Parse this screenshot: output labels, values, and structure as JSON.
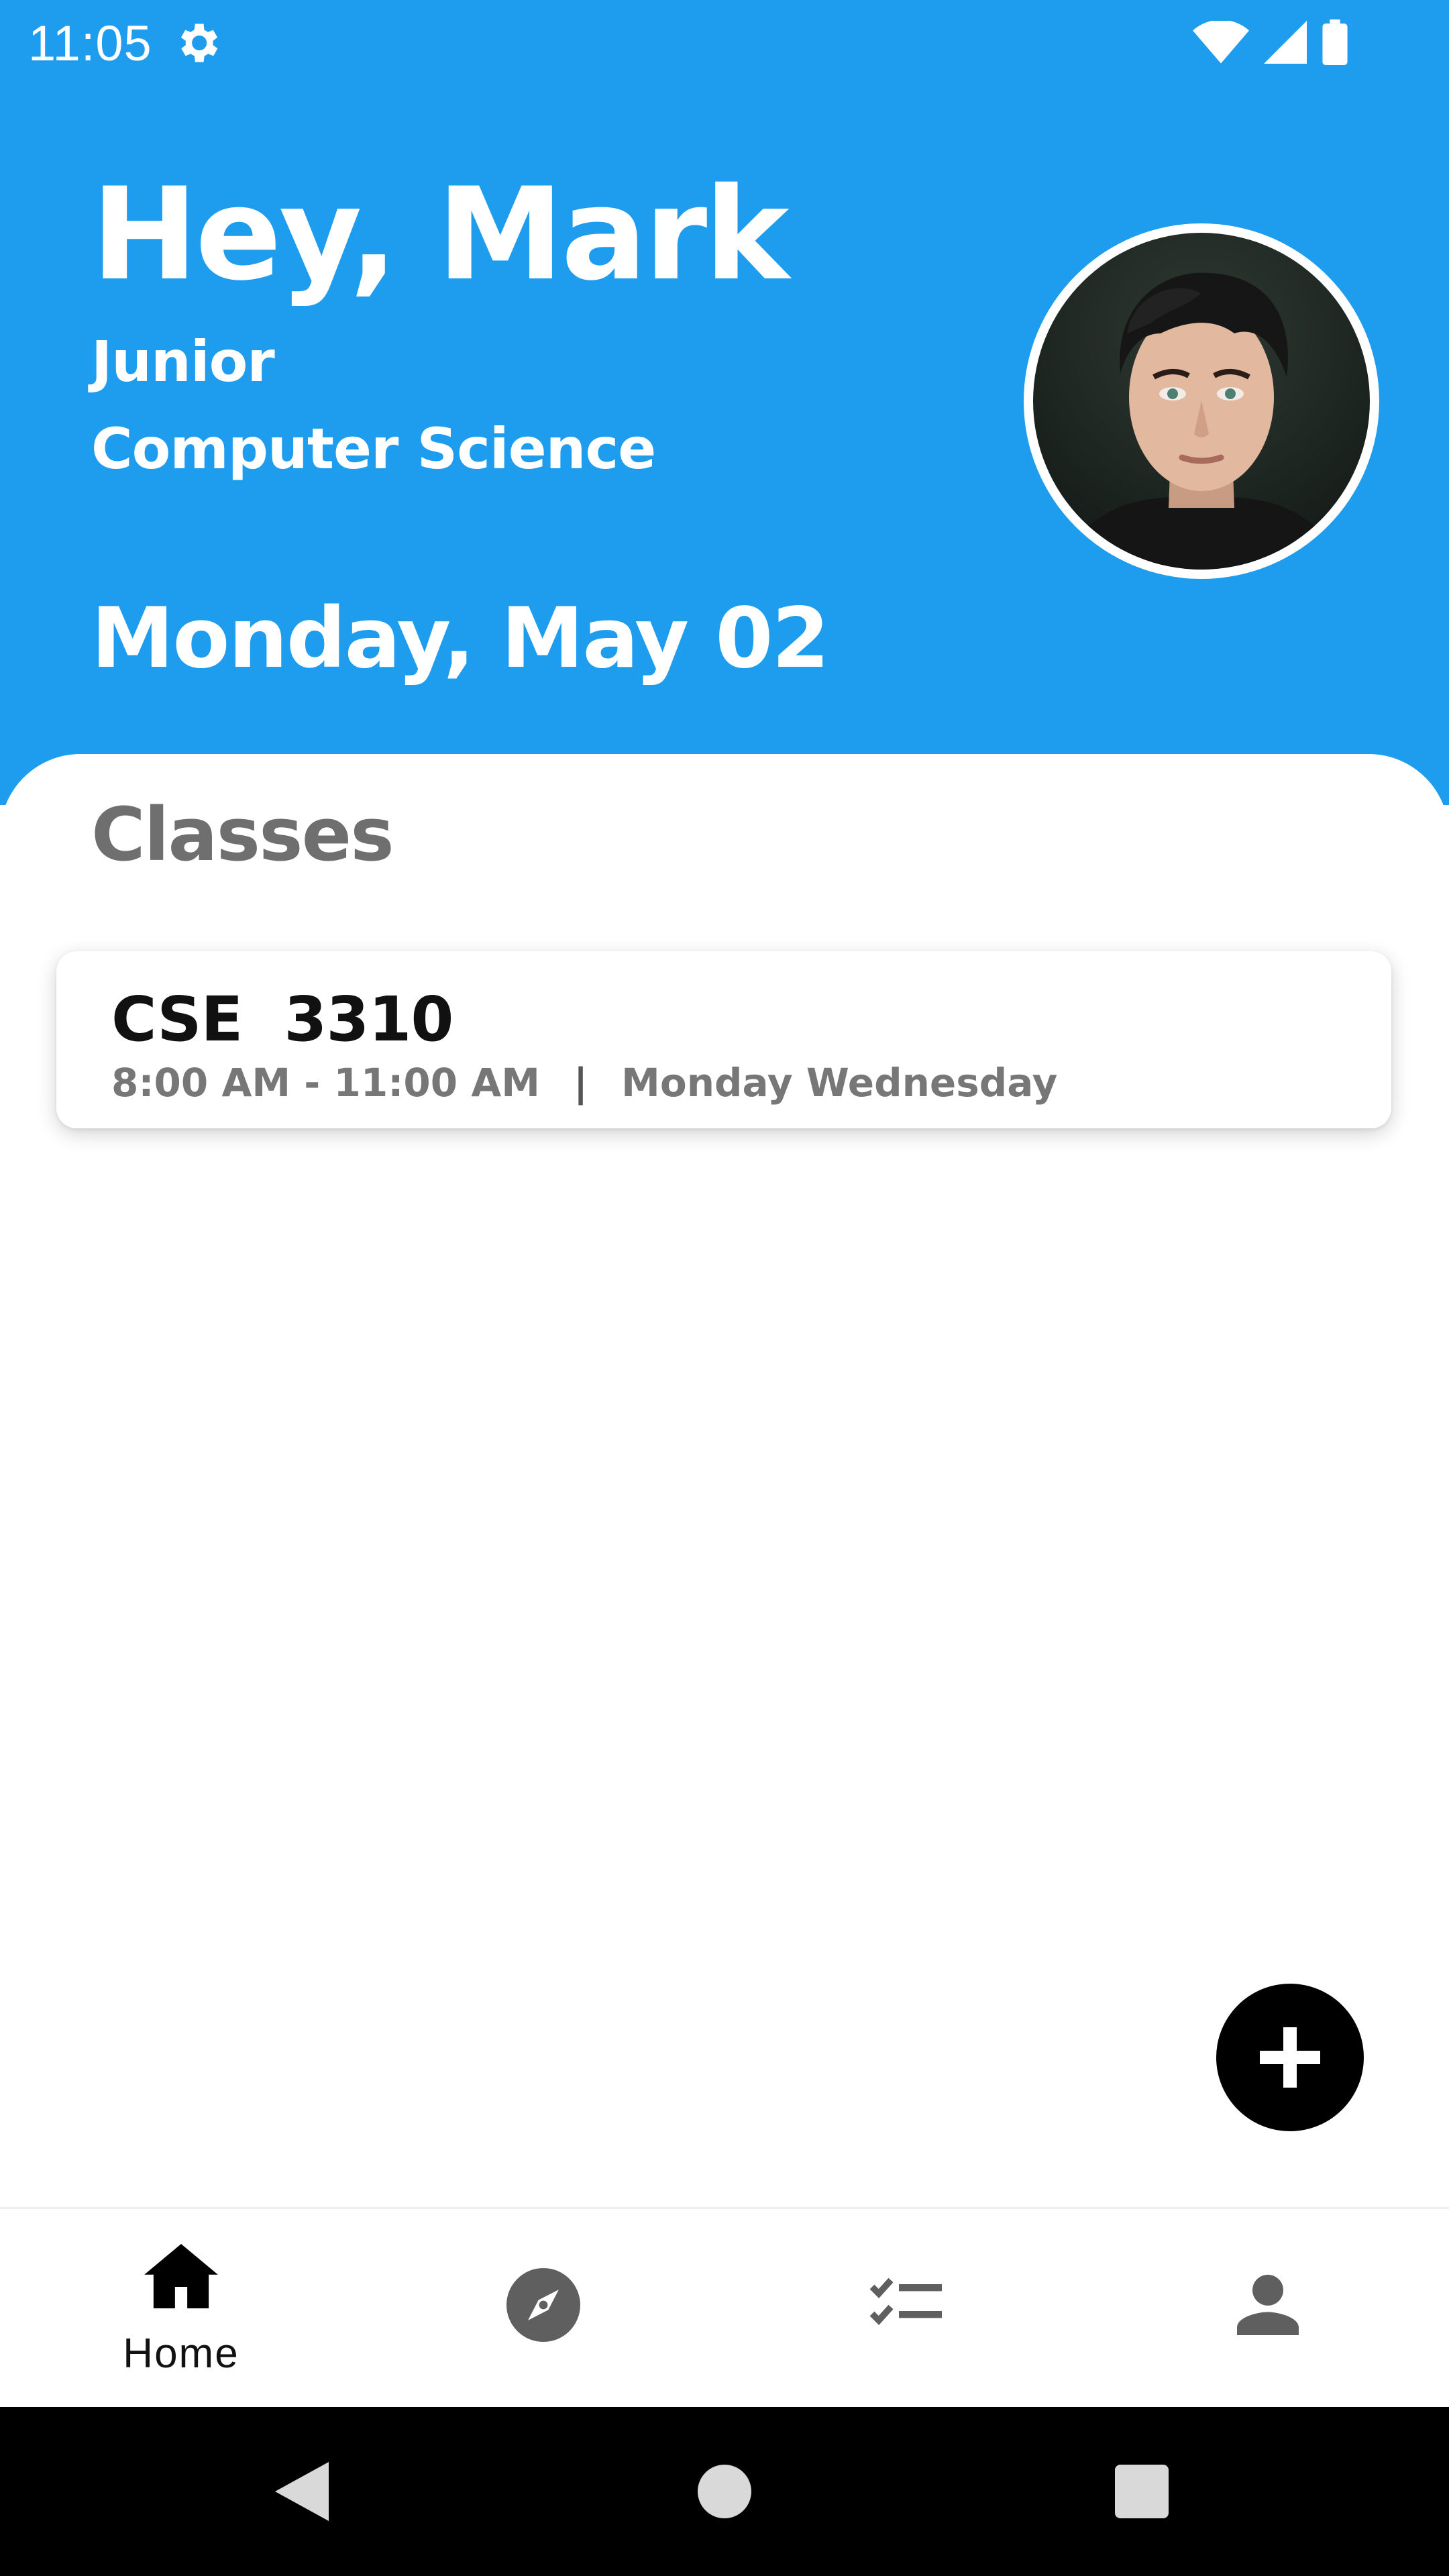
{
  "status_bar": {
    "time": "11:05"
  },
  "header": {
    "greeting": "Hey, Mark",
    "year": "Junior",
    "major": "Computer Science",
    "date": "Monday, May 02"
  },
  "classes": {
    "title": "Classes",
    "items": [
      {
        "code": "CSE  3310",
        "time": "8:00 AM - 11:00 AM",
        "separator": "|",
        "days": "Monday Wednesday"
      }
    ]
  },
  "bottom_nav": {
    "items": [
      {
        "label": "Home",
        "icon": "home-icon",
        "active": true
      },
      {
        "label": "",
        "icon": "compass-icon",
        "active": false
      },
      {
        "label": "",
        "icon": "checklist-icon",
        "active": false
      },
      {
        "label": "",
        "icon": "person-icon",
        "active": false
      }
    ]
  },
  "colors": {
    "primary": "#1e9def",
    "fab": "#000000",
    "muted_text": "#777777",
    "icon_gray": "#5f5f5f"
  }
}
